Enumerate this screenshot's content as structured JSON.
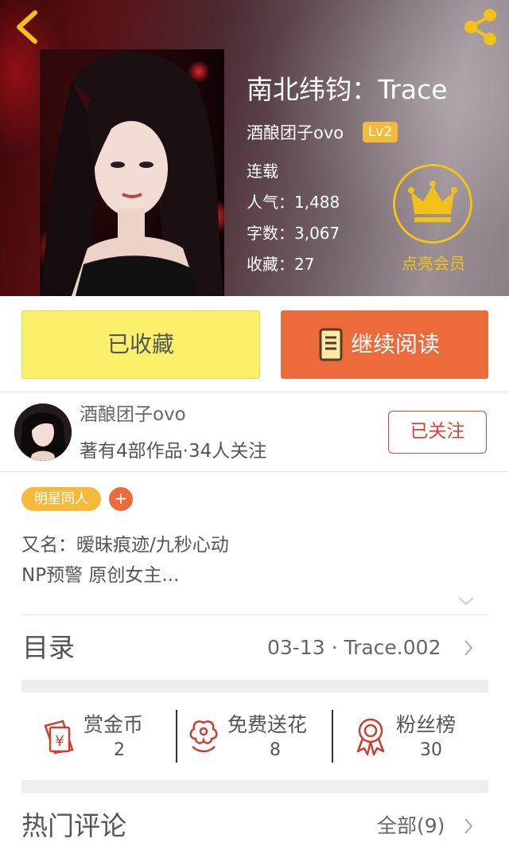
{
  "header": {
    "book_title": "南北纬钧：Trace",
    "author": "酒酿团子ovo",
    "level": "Lv2",
    "status": "连载",
    "popularity": "人气：1,488",
    "word_count": "字数：3,067",
    "favorites": "收藏：27",
    "vip_label": "点亮会员"
  },
  "actions": {
    "favorite_label": "已收藏",
    "read_label": "继续阅读"
  },
  "author_info": {
    "name": "酒酿团子ovo",
    "stats": "著有4部作品·34人关注",
    "follow_label": "已关注"
  },
  "tags": [
    "明星同人"
  ],
  "tag_add": "+",
  "description": {
    "line1": "又名：暧昧痕迹/九秒心动",
    "line2": "NP预警 原创女主..."
  },
  "catalog": {
    "title": "目录",
    "latest": "03-13 · Trace.002"
  },
  "stats": {
    "reward": {
      "label": "赏金币",
      "value": "2"
    },
    "flowers": {
      "label": "免费送花",
      "value": "8"
    },
    "fans": {
      "label": "粉丝榜",
      "value": "30"
    }
  },
  "comments": {
    "title": "热门评论",
    "all_label": "全部(9)"
  },
  "colors": {
    "accent_orange": "#ec6a3b",
    "fav_yellow": "#fbf06a",
    "badge_gold": "#f5b93c",
    "vip_gold": "#f2c21a",
    "follow_red": "#d9443a"
  },
  "icons": {
    "back": "back-arrow-icon",
    "share": "share-icon",
    "vip": "crown-icon",
    "read": "book-icon",
    "reward": "red-envelope-yen-icon",
    "flowers": "flower-icon",
    "fans": "ribbon-medal-icon",
    "expand": "chevron-down-icon",
    "more": "chevron-right-icon"
  }
}
